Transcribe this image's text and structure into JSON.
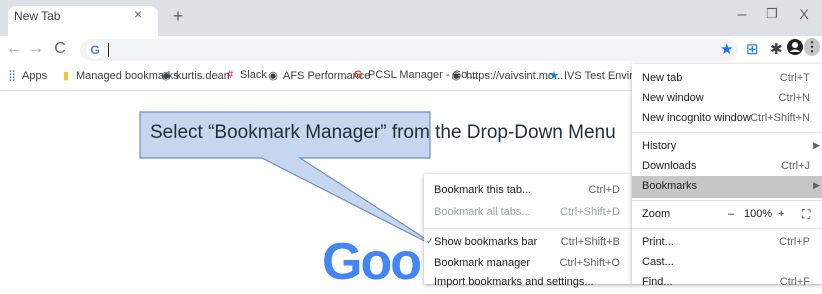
{
  "tab": {
    "title": "New Tab",
    "close": "×",
    "new_tab": "+"
  },
  "window": {
    "minimize": "–",
    "restore": "❐",
    "close": "X"
  },
  "nav": {
    "back": "←",
    "forward": "→",
    "reload": "C",
    "google_badge": "G"
  },
  "bookmarks_bar": [
    {
      "label": "Apps",
      "icon": "apps-grid-icon"
    },
    {
      "label": "Managed bookmarks",
      "icon": "folder-icon"
    },
    {
      "label": "kurtis.dean",
      "icon": "globe-icon"
    },
    {
      "label": "Slack",
      "icon": "slack-icon"
    },
    {
      "label": "AFS Performance",
      "icon": "globe-icon"
    },
    {
      "label": "PCSL Manager - Go...",
      "icon": "google-icon"
    },
    {
      "label": "https://vaivsint.mo...",
      "icon": "globe-icon"
    },
    {
      "label": "IVS Test Environmen",
      "icon": "star-icon"
    }
  ],
  "callout": {
    "text": "Select “Bookmark Manager” from the Drop-Down Menu"
  },
  "google_logo": "Goo",
  "main_menu": {
    "new_tab": {
      "label": "New tab",
      "shortcut": "Ctrl+T"
    },
    "new_window": {
      "label": "New window",
      "shortcut": "Ctrl+N"
    },
    "new_incognito": {
      "label": "New incognito window",
      "shortcut": "Ctrl+Shift+N"
    },
    "history": {
      "label": "History"
    },
    "downloads": {
      "label": "Downloads",
      "shortcut": "Ctrl+J"
    },
    "bookmarks": {
      "label": "Bookmarks"
    },
    "zoom": {
      "label": "Zoom",
      "minus": "–",
      "value": "100%",
      "plus": "+"
    },
    "print": {
      "label": "Print...",
      "shortcut": "Ctrl+P"
    },
    "cast": {
      "label": "Cast..."
    },
    "find": {
      "label": "Find...",
      "shortcut": "Ctrl+F"
    }
  },
  "sub_menu": {
    "bookmark_tab": {
      "label": "Bookmark this tab...",
      "shortcut": "Ctrl+D"
    },
    "bookmark_all": {
      "label": "Bookmark all tabs...",
      "shortcut": "Ctrl+Shift+D"
    },
    "show_bar": {
      "label": "Show bookmarks bar",
      "shortcut": "Ctrl+Shift+B",
      "check": "✓"
    },
    "manager": {
      "label": "Bookmark manager",
      "shortcut": "Ctrl+Shift+O"
    },
    "import": {
      "label": "Import bookmarks and settings..."
    }
  },
  "colors": {
    "accent": "#1a73e8",
    "callout_fill": "#c5d6ee",
    "callout_border": "#6f8fbf",
    "highlight": "#c6c6c6"
  }
}
